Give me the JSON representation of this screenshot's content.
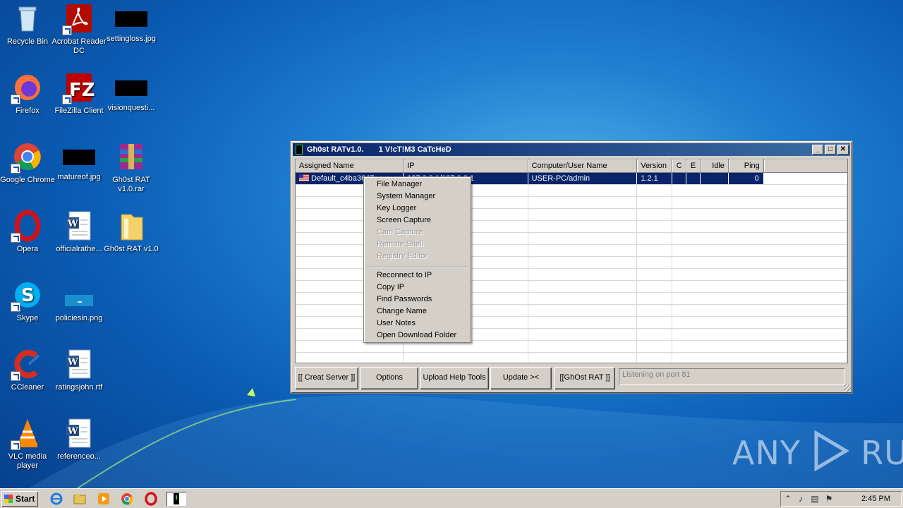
{
  "desktop": {
    "icons": [
      {
        "label": "Recycle Bin"
      },
      {
        "label": "Acrobat Reader DC"
      },
      {
        "label": "settingloss.jpg"
      },
      {
        "label": "Firefox"
      },
      {
        "label": "FileZilla Client"
      },
      {
        "label": "visionquesti..."
      },
      {
        "label": "Google Chrome"
      },
      {
        "label": "matureof.jpg"
      },
      {
        "label": "Gh0st RAT v1.0.rar"
      },
      {
        "label": "Opera"
      },
      {
        "label": "officialrathe..."
      },
      {
        "label": "Gh0st RAT v1.0"
      },
      {
        "label": "Skype"
      },
      {
        "label": "policiesin.png"
      },
      {
        "label": "CCleaner"
      },
      {
        "label": "ratingsjohn.rtf"
      },
      {
        "label": "VLC media player"
      },
      {
        "label": "referenceo..."
      }
    ]
  },
  "window": {
    "title": "Gh0st RATv1.0.",
    "subtitle": "1 V!cT!M3 CaTcHeD",
    "controls": {
      "minimize": "_",
      "maximize": "□",
      "close": "✕"
    },
    "columns": [
      "Assigned Name",
      "IP",
      "Computer/User Name",
      "Version",
      "C",
      "E",
      "Idle",
      "Ping"
    ],
    "rows": [
      {
        "name": "Default_c4ba3647",
        "ip": "127.0.0.1/127.0.0.1",
        "computer": "USER-PC/admin",
        "version": "1.2.1",
        "c": "",
        "e": "",
        "idle": "",
        "ping": "0"
      }
    ],
    "buttons": [
      "[[ Creat Server ]]",
      "Options",
      "Upload Help Tools",
      "Update ><",
      "[[GhOst RAT ]]"
    ],
    "status": "Listening on port 81"
  },
  "context_menu": {
    "group1": [
      {
        "label": "File Manager",
        "enabled": true
      },
      {
        "label": "System Manager",
        "enabled": true
      },
      {
        "label": "Key Logger",
        "enabled": true
      },
      {
        "label": "Screen Capture",
        "enabled": true
      },
      {
        "label": "Cam Capture",
        "enabled": false
      },
      {
        "label": "Remote Shell",
        "enabled": false
      },
      {
        "label": "Registry Editor",
        "enabled": false
      }
    ],
    "group2": [
      {
        "label": "Reconnect to IP",
        "enabled": true
      },
      {
        "label": "Copy IP",
        "enabled": true
      },
      {
        "label": "Find Passwords",
        "enabled": true
      },
      {
        "label": "Change Name",
        "enabled": true
      },
      {
        "label": "User Notes",
        "enabled": true
      },
      {
        "label": "Open Download Folder",
        "enabled": true
      }
    ]
  },
  "taskbar": {
    "start_label": "Start",
    "clock": "2:45 PM",
    "quick_launch": [
      "internet-explorer-icon",
      "explorer-icon",
      "media-player-icon",
      "chrome-icon",
      "opera-icon",
      "gh0st-rat-icon"
    ]
  },
  "watermark": {
    "left": "ANY",
    "right": "RUN"
  }
}
